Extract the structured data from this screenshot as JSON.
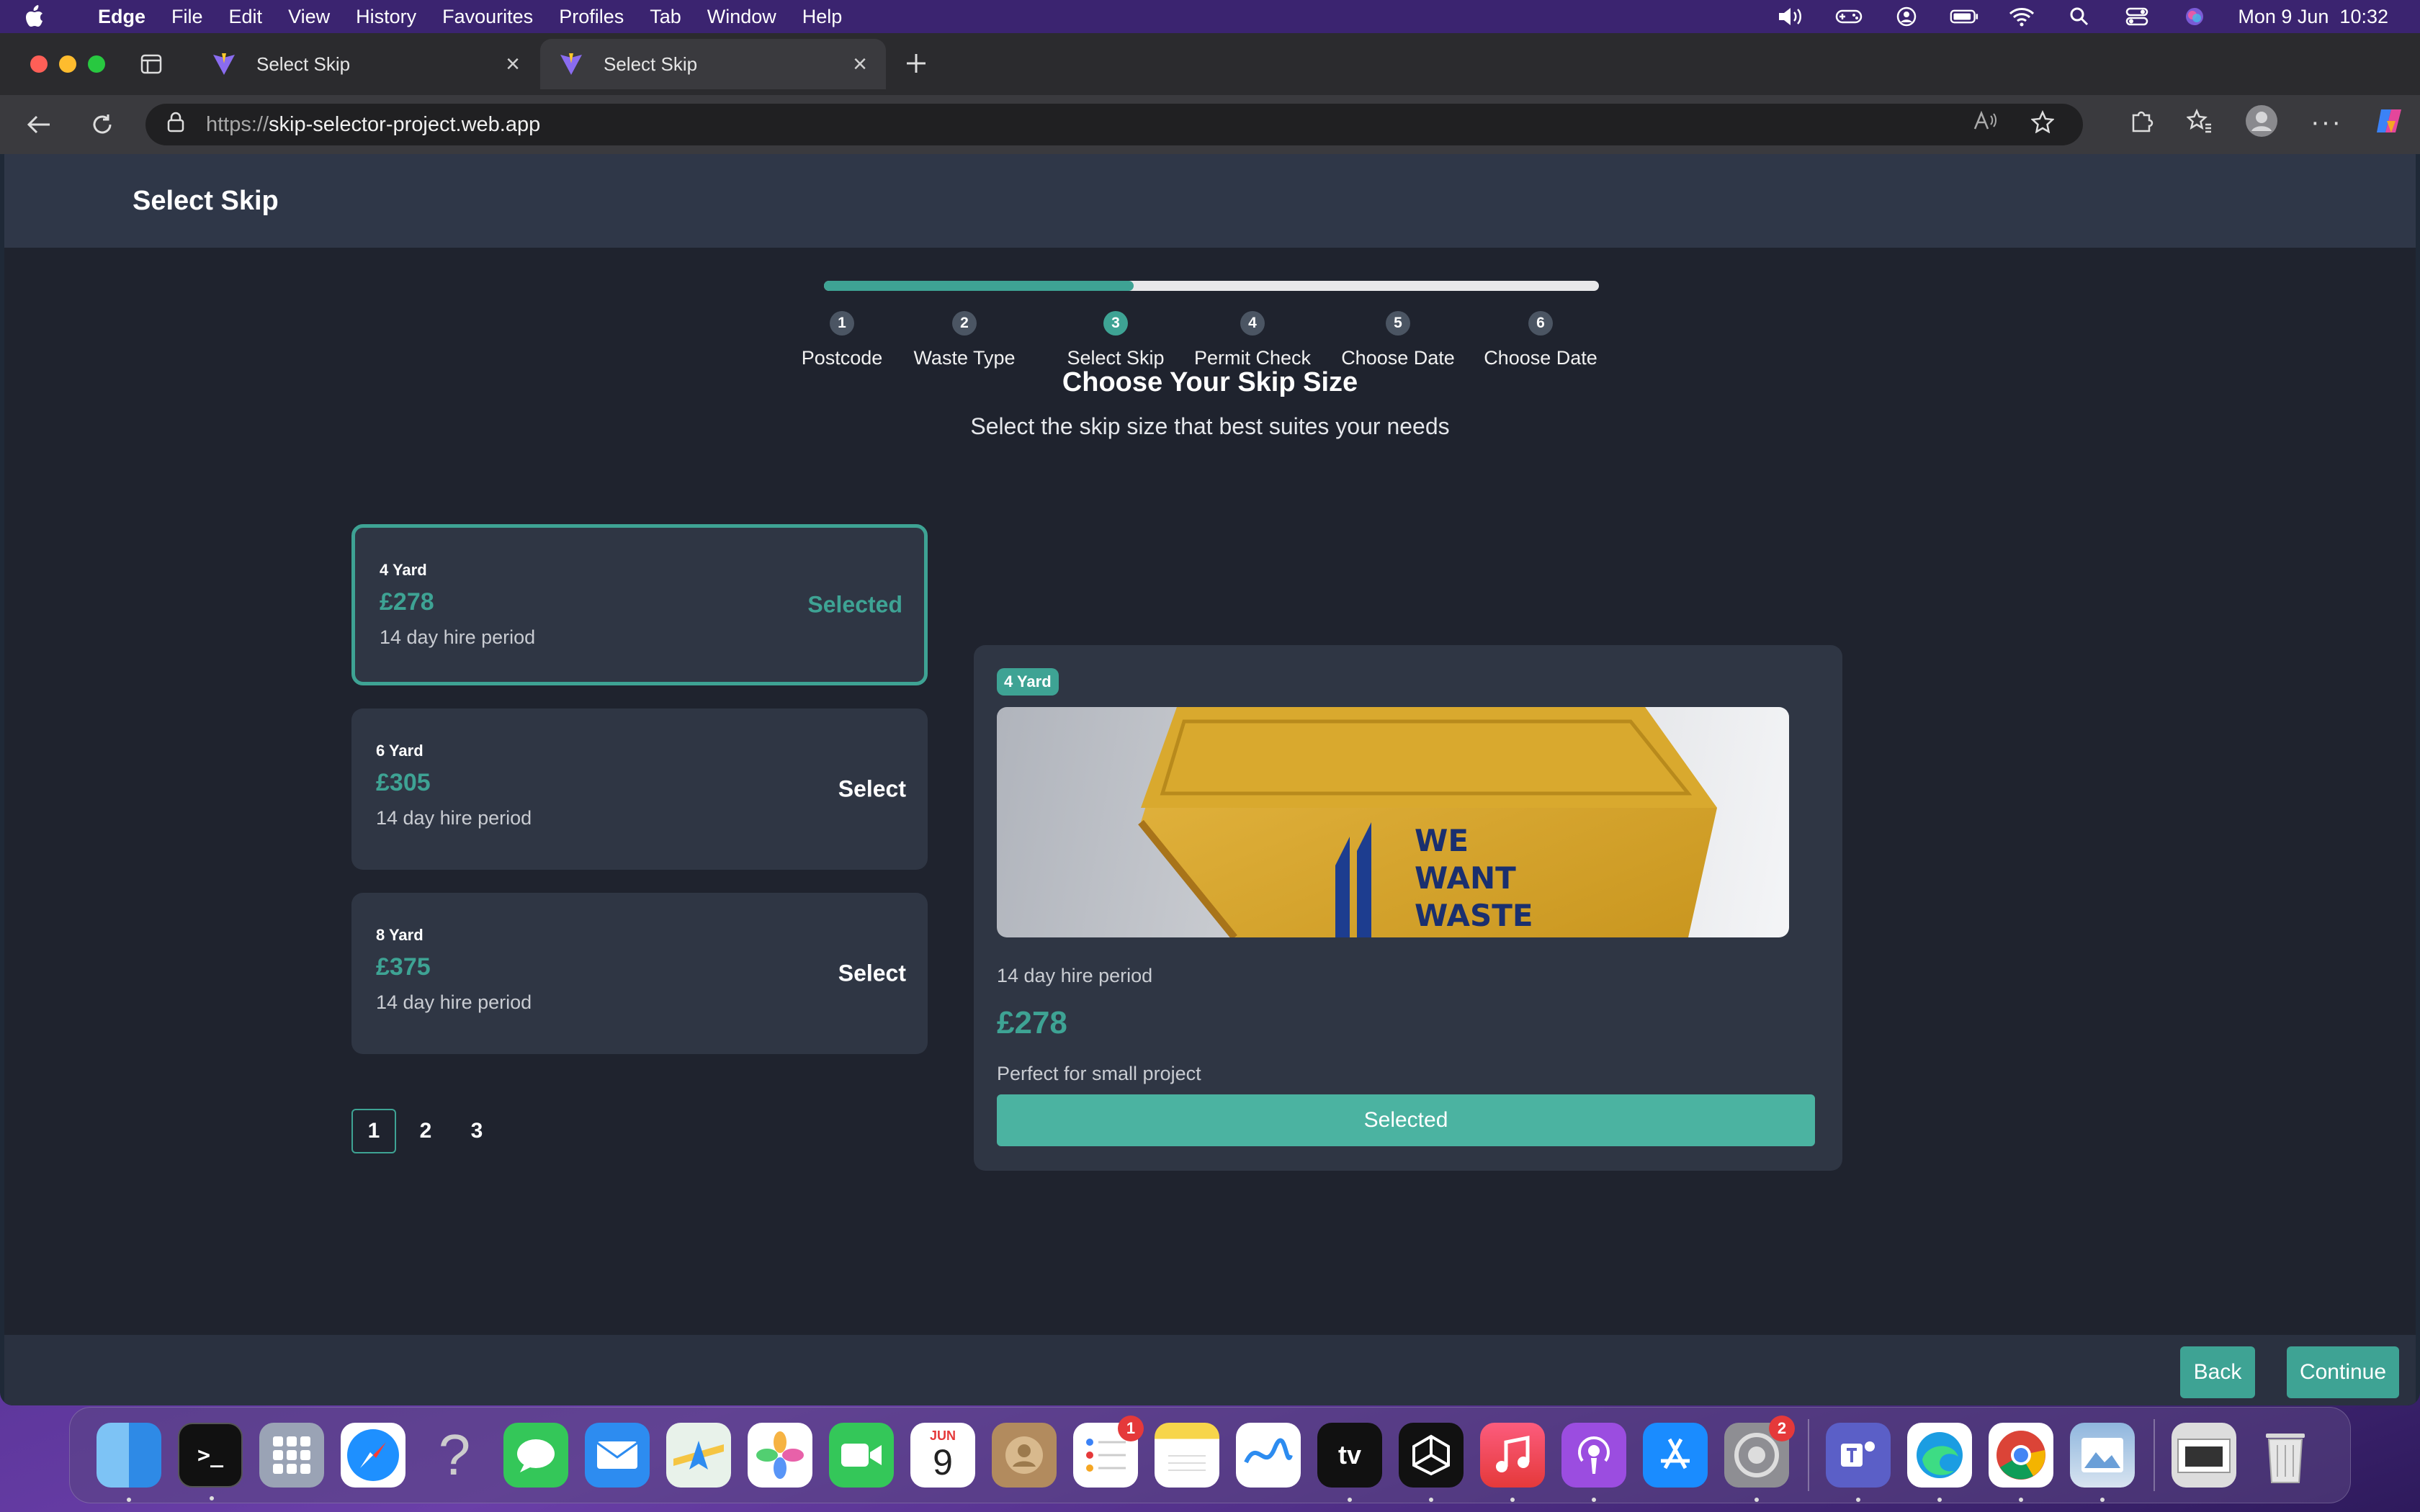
{
  "menubar": {
    "app_name": "Edge",
    "items": [
      "File",
      "Edit",
      "View",
      "History",
      "Favourites",
      "Profiles",
      "Tab",
      "Window",
      "Help"
    ],
    "clock": "Mon 9 Jun  10:32"
  },
  "browser": {
    "tabs": [
      {
        "title": "Select Skip"
      },
      {
        "title": "Select Skip"
      }
    ],
    "url_proto": "https://",
    "url_host": "skip-selector-project.web.app"
  },
  "app": {
    "header_title": "Select Skip",
    "progress_fraction": 0.4,
    "steps": [
      {
        "num": "1",
        "label": "Postcode"
      },
      {
        "num": "2",
        "label": "Waste Type"
      },
      {
        "num": "3",
        "label": "Select Skip"
      },
      {
        "num": "4",
        "label": "Permit Check"
      },
      {
        "num": "5",
        "label": "Choose Date"
      },
      {
        "num": "6",
        "label": "Choose Date"
      }
    ],
    "active_step": 3,
    "heading": "Choose Your Skip Size",
    "subheading": "Select the skip size that best suites your needs",
    "skips": [
      {
        "size": "4 Yard",
        "price": "£278",
        "period": "14 day hire period",
        "action": "Selected"
      },
      {
        "size": "6 Yard",
        "price": "£305",
        "period": "14 day hire period",
        "action": "Select"
      },
      {
        "size": "8 Yard",
        "price": "£375",
        "period": "14 day hire period",
        "action": "Select"
      }
    ],
    "pagination": [
      "1",
      "2",
      "3"
    ],
    "detail": {
      "badge": "4 Yard",
      "image_text": [
        "WE",
        "WANT",
        "WASTE"
      ],
      "period": "14 day hire period",
      "price": "£278",
      "description": "Perfect for small project",
      "button": "Selected"
    },
    "back_label": "Back",
    "continue_label": "Continue"
  },
  "dock": {
    "calendar_month": "JUN",
    "calendar_day": "9",
    "reminders_badge": "1",
    "settings_badge": "2",
    "tv_label": "tv"
  },
  "colors": {
    "accent": "#3ea394",
    "page_bg": "#1f232e",
    "card_bg": "#2f3644"
  }
}
